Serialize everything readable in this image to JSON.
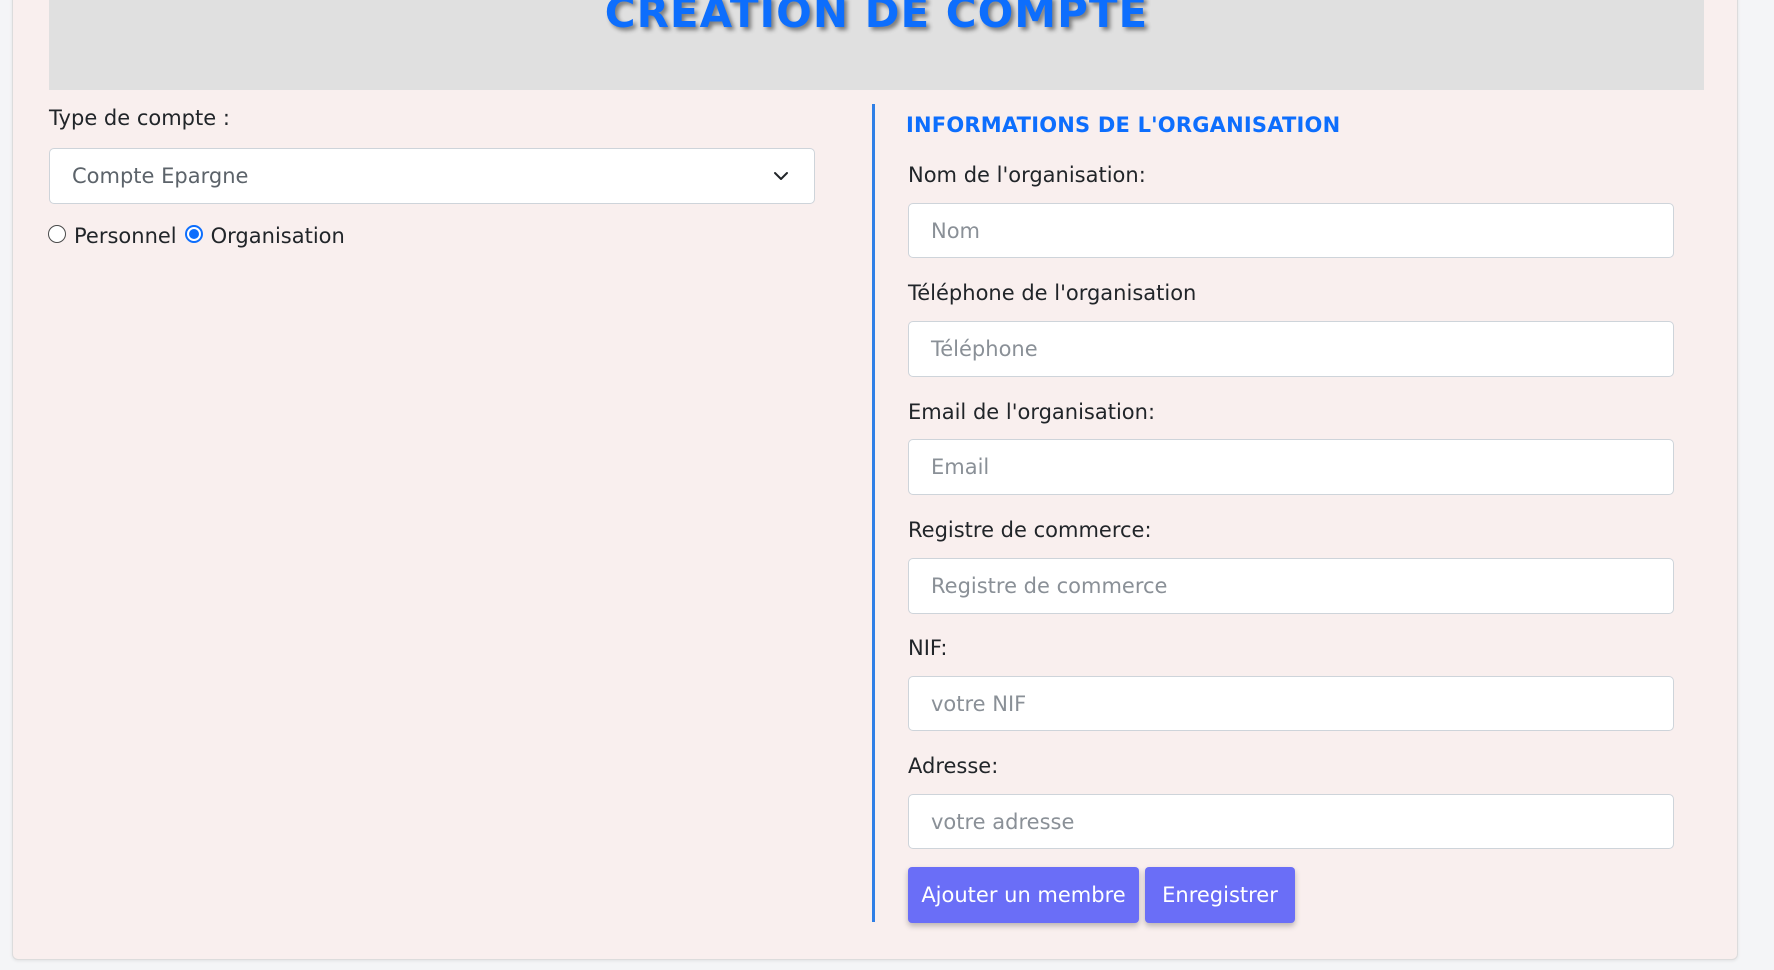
{
  "header": {
    "title": "CRÉATION DE COMPTE"
  },
  "left": {
    "account_type_label": "Type de compte :",
    "account_type_value": "Compte Epargne",
    "radios": [
      {
        "label": "Personnel",
        "checked": false
      },
      {
        "label": "Organisation",
        "checked": true
      }
    ]
  },
  "org": {
    "section_title": "INFORMATIONS DE L'ORGANISATION",
    "fields": [
      {
        "label": "Nom de l'organisation:",
        "placeholder": "Nom"
      },
      {
        "label": "Téléphone de l'organisation",
        "placeholder": "Téléphone"
      },
      {
        "label": "Email de l'organisation:",
        "placeholder": "Email"
      },
      {
        "label": "Registre de commerce:",
        "placeholder": "Registre de commerce"
      },
      {
        "label": "NIF:",
        "placeholder": "votre NIF"
      },
      {
        "label": "Adresse:",
        "placeholder": "votre adresse"
      }
    ]
  },
  "buttons": {
    "add_member": "Ajouter un membre",
    "save": "Enregistrer"
  },
  "colors": {
    "accent": "#0d6efd",
    "button": "#6a6ef7",
    "card_bg": "#f9efee",
    "header_bg": "#e0e0e0",
    "divider": "#2f7fe6"
  },
  "icons": {
    "select": "chevron-down-icon"
  }
}
